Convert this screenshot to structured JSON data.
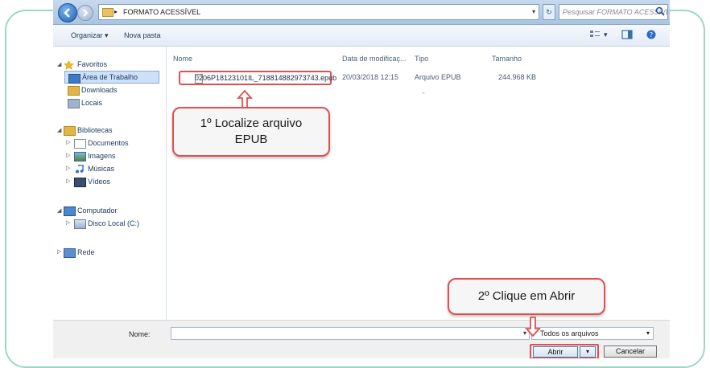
{
  "window": {
    "path_segment": "FORMATO ACESSÍVEL",
    "search_placeholder": "Pesquisar FORMATO ACESSÍVEL"
  },
  "toolbar": {
    "organize_label": "Organizar ▾",
    "new_folder_label": "Nova pasta"
  },
  "sidebar": {
    "favorites": "Favoritos",
    "desktop": "Área de Trabalho",
    "downloads": "Downloads",
    "locais": "Locais",
    "libraries": "Bibliotecas",
    "documents": "Documentos",
    "images": "Imagens",
    "music": "Músicas",
    "videos": "Vídeos",
    "computer": "Computador",
    "local_disk": "Disco Local (C:)",
    "network": "Rede"
  },
  "columns": {
    "name": "Nome",
    "modified": "Data de modificaç...",
    "type": "Tipo",
    "size": "Tamanho"
  },
  "files": [
    {
      "name": "0206P18123101IL_718814882973743.epub",
      "modified": "20/03/2018 12:15",
      "type": "Arquivo EPUB",
      "size": "244.968 KB"
    }
  ],
  "footer": {
    "name_label": "Nome:",
    "file_type": "Todos os arquivos",
    "open_label": "Abrir",
    "cancel_label": "Cancelar"
  },
  "callouts": {
    "step1": "1º Localize arquivo EPUB",
    "step2": "2º Clique em Abrir"
  },
  "colors": {
    "highlight": "#e05050",
    "frame": "#9dd6c9"
  }
}
